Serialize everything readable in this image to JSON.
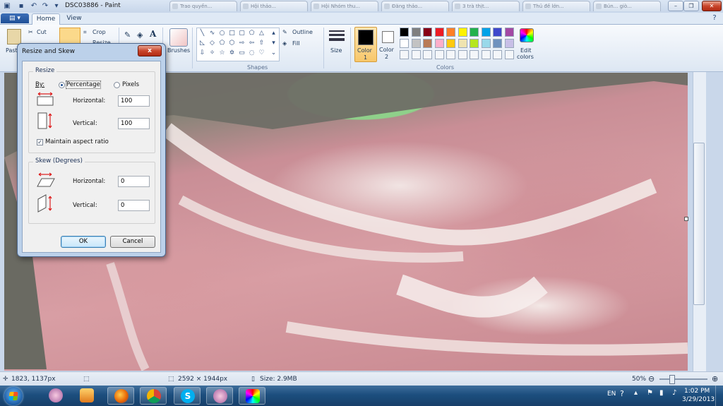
{
  "titlebar": {
    "title": "DSC03886 - Paint",
    "other_tabs": [
      "Trao quyền...",
      "Hội thảo...",
      "Hội Nhóm thu...",
      "Đăng thảo...",
      "3 trà thịt...",
      "Thủ đề lớn...",
      "Bún... giò..."
    ]
  },
  "tabs": {
    "file_label": "▤ ▾",
    "home": "Home",
    "view": "View"
  },
  "ribbon": {
    "paste_label": "Paste",
    "cut_label": "Cut",
    "crop_label": "Crop",
    "resize_label": "Resize",
    "brushes_label": "Brushes",
    "outline_label": "Outline",
    "fill_label": "Fill",
    "shapes_group_label": "Shapes",
    "size_label": "Size",
    "color1_label": "Color",
    "color1_num": "1",
    "color2_label": "Color",
    "color2_num": "2",
    "edit_colors_label": "Edit",
    "edit_colors_label2": "colors",
    "colors_group_label": "Colors",
    "color1_value": "#000000",
    "color2_value": "#ffffff",
    "palette_row1": [
      "#000000",
      "#7f7f7f",
      "#880015",
      "#ed1c24",
      "#ff7f27",
      "#fff200",
      "#22b14c",
      "#00a2e8",
      "#3f48cc",
      "#a349a4"
    ],
    "palette_row2": [
      "#ffffff",
      "#c3c3c3",
      "#b97a57",
      "#ffaec9",
      "#ffc90e",
      "#efe4b0",
      "#b5e61d",
      "#99d9ea",
      "#7092be",
      "#c8bfe7"
    ]
  },
  "dialog": {
    "title": "Resize and Skew",
    "close_label": "x",
    "resize_legend": "Resize",
    "by_label": "By:",
    "percentage_label": "Percentage",
    "pixels_label": "Pixels",
    "selected_mode": "Percentage",
    "horizontal_label": "Horizontal:",
    "vertical_label": "Vertical:",
    "resize_horizontal_value": "100",
    "resize_vertical_value": "100",
    "maintain_aspect_label": "Maintain aspect ratio",
    "maintain_aspect_checked": true,
    "skew_legend": "Skew (Degrees)",
    "skew_horizontal_value": "0",
    "skew_vertical_value": "0",
    "ok_label": "OK",
    "cancel_label": "Cancel"
  },
  "statusbar": {
    "cursor_pos": "1823, 1137px",
    "image_size": "2592 × 1944px",
    "file_size": "Size: 2.9MB",
    "zoom": "50%"
  },
  "taskbar": {
    "language": "EN",
    "time": "1:02 PM",
    "date": "3/29/2013"
  }
}
